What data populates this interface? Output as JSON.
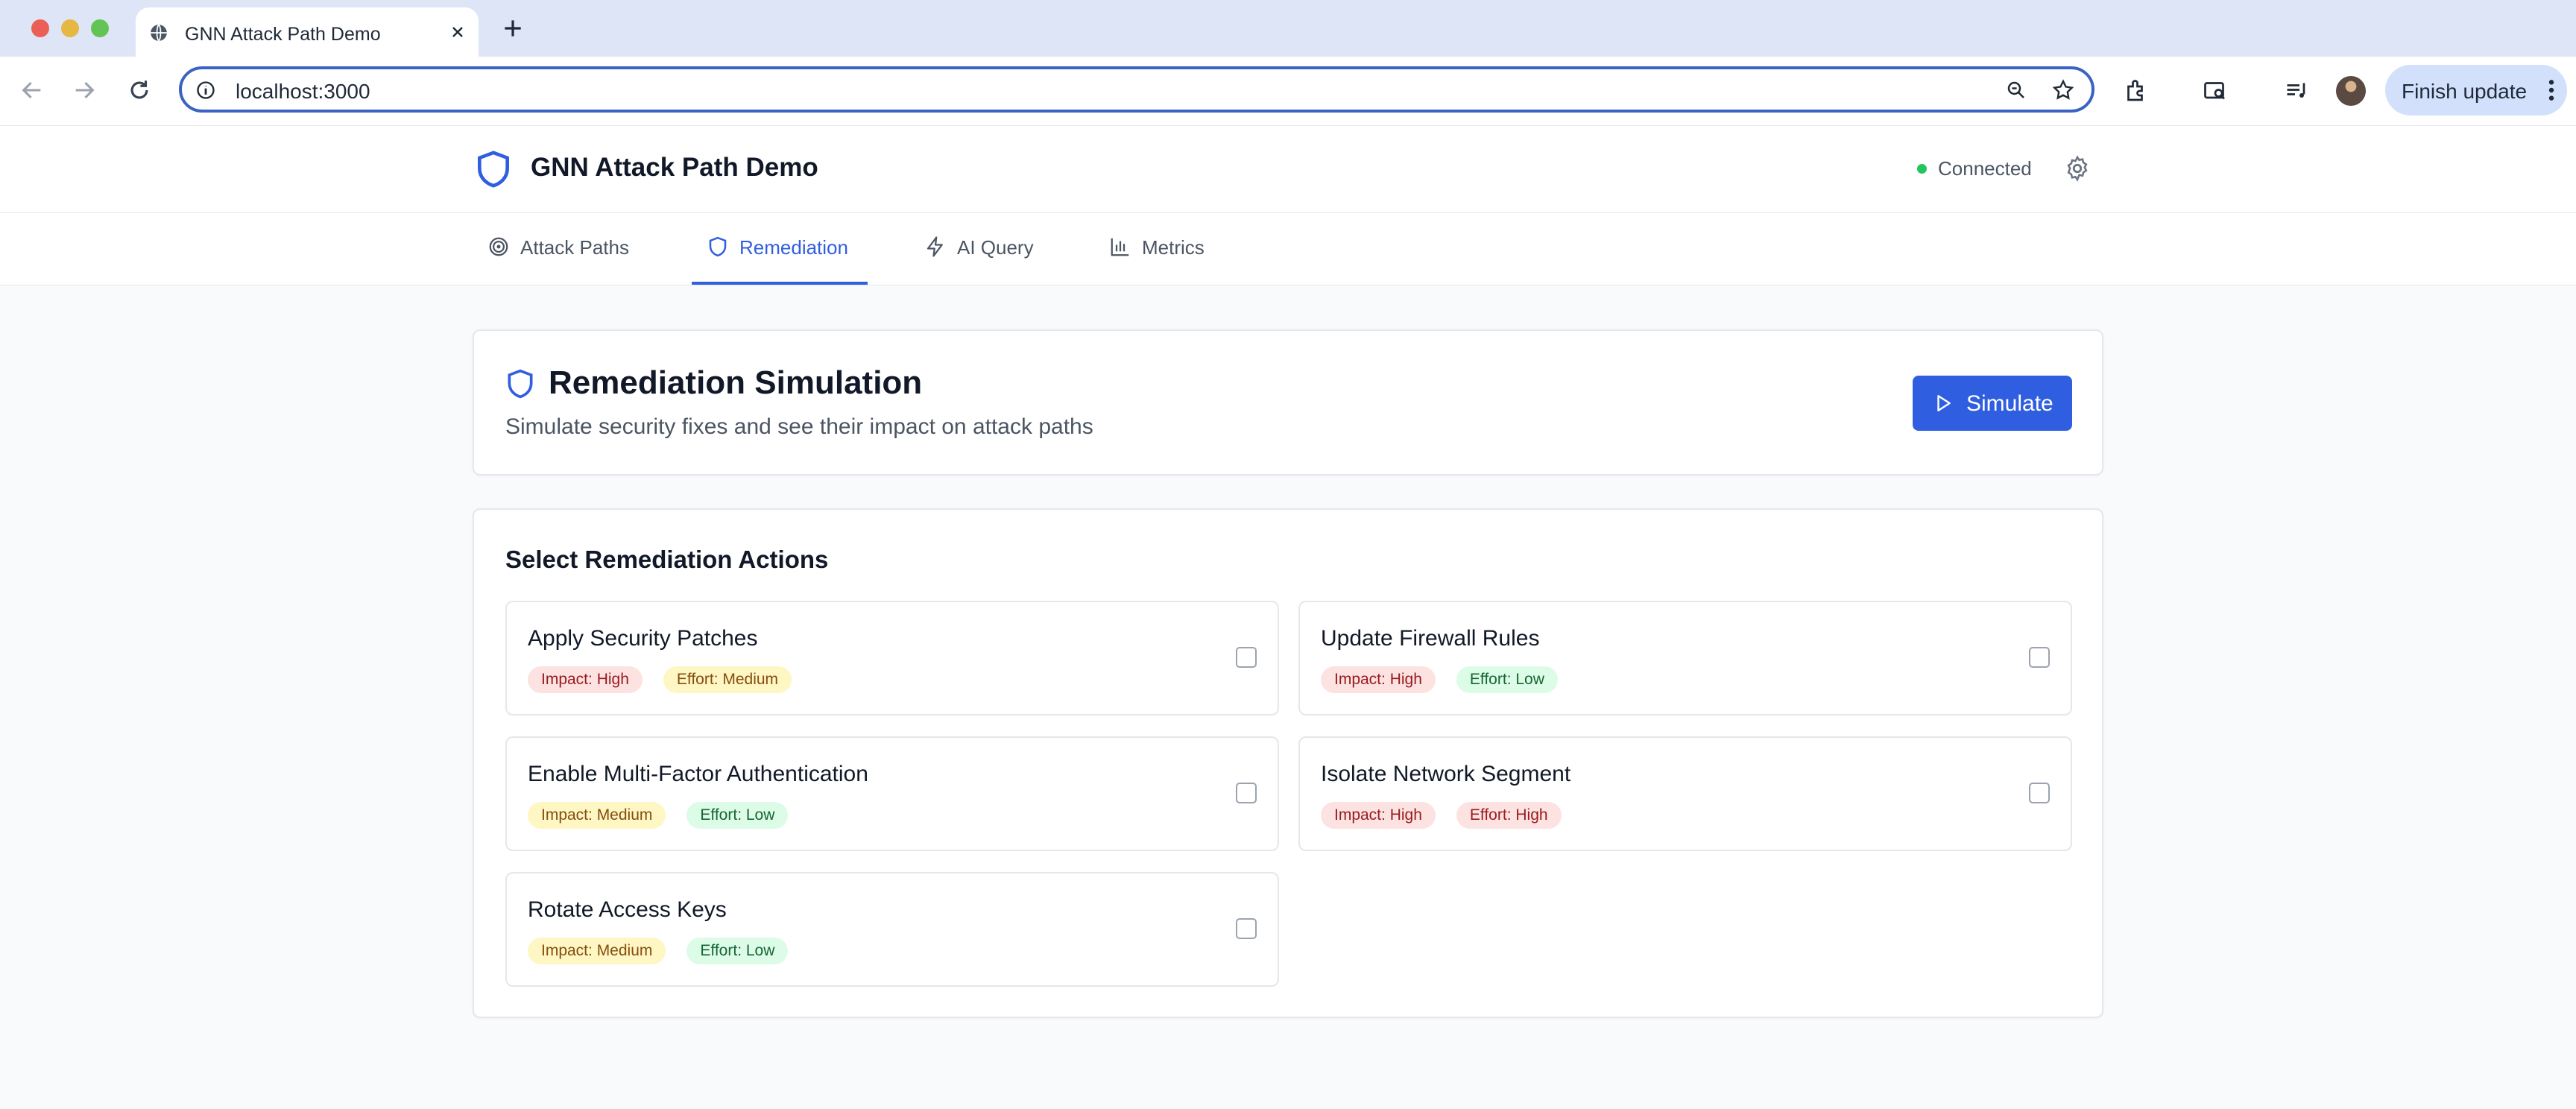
{
  "browser": {
    "tab_title": "GNN Attack Path Demo",
    "url": "localhost:3000",
    "finish_update_label": "Finish update"
  },
  "app": {
    "title": "GNN Attack Path Demo",
    "status": "Connected",
    "status_color": "#22c55e",
    "accent_color": "#2f5ee0"
  },
  "tabs": [
    {
      "label": "Attack Paths",
      "icon": "target-icon"
    },
    {
      "label": "Remediation",
      "icon": "shield-icon",
      "active": true
    },
    {
      "label": "AI Query",
      "icon": "lightning-icon"
    },
    {
      "label": "Metrics",
      "icon": "bar-chart-icon"
    }
  ],
  "simulation": {
    "title": "Remediation Simulation",
    "subtitle": "Simulate security fixes and see their impact on attack paths",
    "button_label": "Simulate"
  },
  "actions_section": {
    "title": "Select Remediation Actions",
    "items": [
      {
        "title": "Apply Security Patches",
        "impact": "Impact: High",
        "effort": "Effort: Medium",
        "checked": false
      },
      {
        "title": "Update Firewall Rules",
        "impact": "Impact: High",
        "effort": "Effort: Low",
        "checked": false
      },
      {
        "title": "Enable Multi-Factor Authentication",
        "impact": "Impact: Medium",
        "effort": "Effort: Low",
        "checked": false
      },
      {
        "title": "Isolate Network Segment",
        "impact": "Impact: High",
        "effort": "Effort: High",
        "checked": false
      },
      {
        "title": "Rotate Access Keys",
        "impact": "Impact: Medium",
        "effort": "Effort: Low",
        "checked": false
      }
    ]
  }
}
